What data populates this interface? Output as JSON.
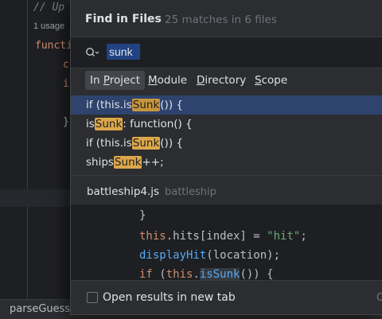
{
  "editor": {
    "comment": "// Up",
    "usages": "1 usage",
    "line_func": "functi",
    "line_c": "c",
    "line_i": "i",
    "line_brace": "}",
    "status_text": "parseGuess()"
  },
  "popup": {
    "title": "Find in Files",
    "subtitle": "25 matches in 6 files",
    "search": {
      "value": "sunk",
      "icon": "search-icon"
    },
    "scopes": [
      {
        "label": "In Project",
        "selected": true
      },
      {
        "label": "Module",
        "selected": false
      },
      {
        "label": "Directory",
        "selected": false
      },
      {
        "label": "Scope",
        "selected": false
      }
    ],
    "results": [
      {
        "before": "if (this.is",
        "match": "Sunk",
        "after": "()) {"
      },
      {
        "before": "is",
        "match": "Sunk",
        "after": ": function() {"
      },
      {
        "before": "if (this.is",
        "match": "Sunk",
        "after": "()) {"
      },
      {
        "before": "ships",
        "match": "Sunk",
        "after": "++;"
      }
    ],
    "file": {
      "name": "battleship4.js",
      "directory": "battleship"
    },
    "preview": {
      "line1": "}",
      "line2_obj": "this",
      "line2_rest": ".hits[index] = ",
      "line2_str": "\"hit\"",
      "line2_end": ";",
      "line3_fn": "displayHit",
      "line3_rest": "(location);",
      "line4_kw": "if",
      "line4_a": " (",
      "line4_obj": "this",
      "line4_dot": ".",
      "line4_call": "isSunk",
      "line4_end": "()) {"
    },
    "footer": {
      "checkbox_label": "Open results in new tab",
      "checked": false,
      "right_glyph": "C"
    }
  }
}
